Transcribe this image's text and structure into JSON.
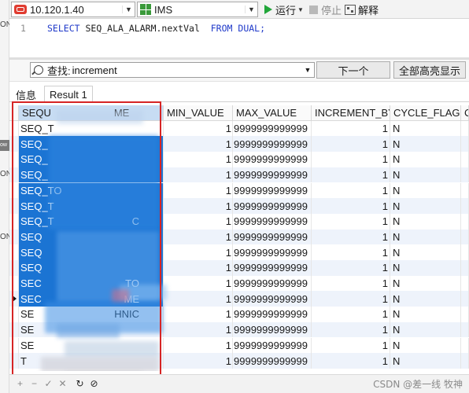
{
  "toolbar": {
    "connection": "10.120.1.40",
    "schema": "IMS",
    "run_label": "运行",
    "stop_label": "停止",
    "explain_label": "解释"
  },
  "editor": {
    "line_number": "1",
    "keyword_select": "SELECT",
    "expression": "SEQ_ALA_ALARM.nextVal",
    "keyword_from": "FROM",
    "source": "DUAL;"
  },
  "find": {
    "label": "查找:",
    "value": "increment",
    "next_label": "下一个",
    "highlight_all_label": "全部高亮显示"
  },
  "tabs": [
    {
      "label": "信息"
    },
    {
      "label": "Result 1"
    }
  ],
  "grid": {
    "columns": [
      "SEQU",
      "ME",
      "MIN_VALUE",
      "MAX_VALUE",
      "INCREMENT_BY",
      "CYCLE_FLAG",
      "C"
    ],
    "rows": [
      {
        "name_start": "SEQ_T",
        "name_end": "",
        "min": "1",
        "max": "9999999999999",
        "inc": "1",
        "cycle": "N"
      },
      {
        "name_start": "SEQ_",
        "name_end": "",
        "min": "1",
        "max": "9999999999999",
        "inc": "1",
        "cycle": "N"
      },
      {
        "name_start": "SEQ_",
        "name_end": "",
        "min": "1",
        "max": "9999999999999",
        "inc": "1",
        "cycle": "N"
      },
      {
        "name_start": "SEQ_",
        "name_end": "",
        "min": "1",
        "max": "9999999999999",
        "inc": "1",
        "cycle": "N"
      },
      {
        "name_start": "SEQ_TO",
        "name_end": "",
        "min": "1",
        "max": "9999999999999",
        "inc": "1",
        "cycle": "N"
      },
      {
        "name_start": "SEQ_T",
        "name_end": "",
        "min": "1",
        "max": "9999999999999",
        "inc": "1",
        "cycle": "N"
      },
      {
        "name_start": "SEQ_T",
        "name_end": "C",
        "min": "1",
        "max": "9999999999999",
        "inc": "1",
        "cycle": "N"
      },
      {
        "name_start": "SEQ",
        "name_end": "",
        "min": "1",
        "max": "9999999999999",
        "inc": "1",
        "cycle": "N"
      },
      {
        "name_start": "SEQ",
        "name_end": "",
        "min": "1",
        "max": "9999999999999",
        "inc": "1",
        "cycle": "N"
      },
      {
        "name_start": "SEQ",
        "name_end": "",
        "min": "1",
        "max": "9999999999999",
        "inc": "1",
        "cycle": "N"
      },
      {
        "name_start": "SEC",
        "name_end": "TO",
        "min": "1",
        "max": "9999999999999",
        "inc": "1",
        "cycle": "N"
      },
      {
        "name_start": "SEC",
        "name_end": "ME",
        "min": "1",
        "max": "9999999999999",
        "inc": "1",
        "cycle": "N"
      },
      {
        "name_start": "SE",
        "name_end": "HNIC",
        "min": "1",
        "max": "9999999999999",
        "inc": "1",
        "cycle": "N"
      },
      {
        "name_start": "SE",
        "name_end": "",
        "min": "1",
        "max": "9999999999999",
        "inc": "1",
        "cycle": "N"
      },
      {
        "name_start": "SE",
        "name_end": "",
        "min": "1",
        "max": "9999999999999",
        "inc": "1",
        "cycle": "N"
      },
      {
        "name_start": "T",
        "name_end": "",
        "min": "1",
        "max": "9999999999999",
        "inc": "1",
        "cycle": "N"
      }
    ]
  },
  "sidebar_fragments": [
    "ON",
    "ow",
    "ON",
    "ON"
  ],
  "watermark": "CSDN @差一线 牧神",
  "icons": {
    "connection": "oracle-connection-icon",
    "schema": "schema-icon",
    "run": "run-icon",
    "stop": "stop-icon",
    "explain": "explain-icon",
    "search": "search-icon"
  },
  "colors": {
    "selection": "#1b74d3",
    "frame": "#d62525",
    "run": "#22a63a",
    "keyword": "#1f39c9"
  }
}
